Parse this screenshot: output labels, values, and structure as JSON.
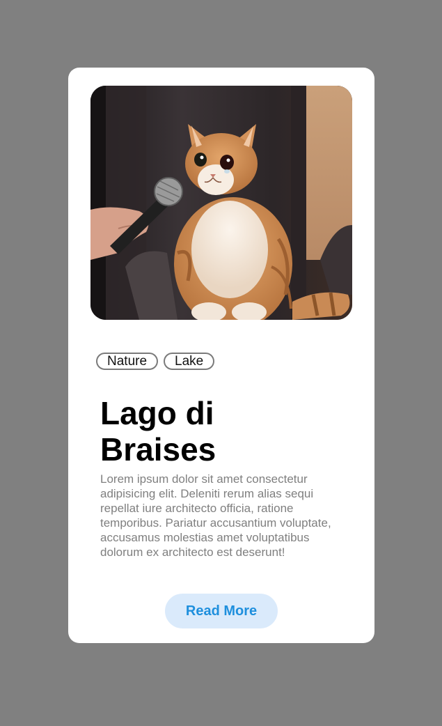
{
  "card": {
    "image": {
      "icon": "crying-cat-microphone-photo"
    },
    "tags": [
      "Nature",
      "Lake"
    ],
    "title": "Lago di Braises",
    "description": "Lorem ipsum dolor sit amet consectetur adipisicing elit. Deleniti rerum alias sequi repellat iure architecto officia, ratione temporibus. Pariatur accusantium voluptate, accusamus molestias amet voluptatibus dolorum ex architecto est deserunt!",
    "button_label": "Read More"
  },
  "colors": {
    "page_background": "#808080",
    "card_background": "#ffffff",
    "button_background": "#daeafb",
    "button_text": "#1e8fdd",
    "description_text": "#7f7f7f"
  }
}
